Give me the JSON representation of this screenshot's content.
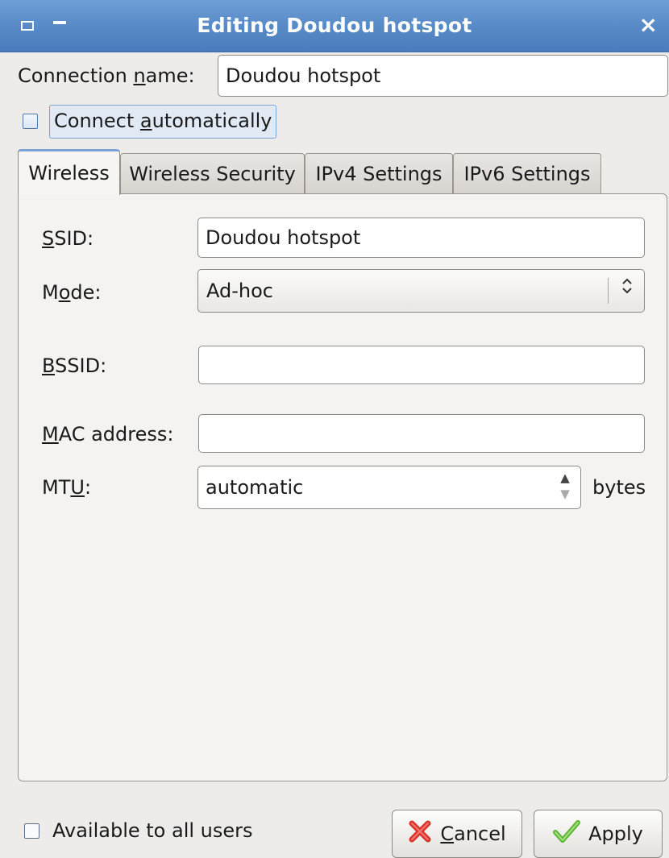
{
  "window": {
    "title": "Editing Doudou hotspot",
    "close_glyph": "×"
  },
  "connection": {
    "name_label_pre": "Connection ",
    "name_label_u": "n",
    "name_label_post": "ame:",
    "name_value": "Doudou hotspot",
    "autoconnect_pre": "Connect ",
    "autoconnect_u": "a",
    "autoconnect_post": "utomatically",
    "autoconnect_checked": false
  },
  "tabs": [
    {
      "label": "Wireless",
      "active": true
    },
    {
      "label": "Wireless Security",
      "active": false
    },
    {
      "label": "IPv4 Settings",
      "active": false
    },
    {
      "label": "IPv6 Settings",
      "active": false
    }
  ],
  "wireless": {
    "ssid_u": "S",
    "ssid_post": "SID:",
    "ssid_value": "Doudou hotspot",
    "mode_pre": "M",
    "mode_u": "o",
    "mode_post": "de:",
    "mode_value": "Ad-hoc",
    "bssid_u": "B",
    "bssid_post": "SSID:",
    "bssid_value": "",
    "mac_u": "M",
    "mac_post": "AC address:",
    "mac_value": "",
    "mtu_pre": "MT",
    "mtu_u": "U",
    "mtu_post": ":",
    "mtu_value": "automatic",
    "mtu_unit": "bytes"
  },
  "footer": {
    "all_users_label": "Available to all users",
    "all_users_checked": false,
    "cancel_u": "C",
    "cancel_post": "ancel",
    "apply_label": "Apply"
  },
  "icons": {
    "window_menu": "window-menu-icon",
    "minimize": "minimize-icon",
    "close": "close-icon",
    "combo_arrows": "updown-arrows-icon",
    "cancel": "red-x-icon",
    "apply": "green-check-icon"
  },
  "colors": {
    "titlebar": "#5a8cc8",
    "cancel_icon": "#d9332b",
    "apply_icon": "#5bb536"
  }
}
